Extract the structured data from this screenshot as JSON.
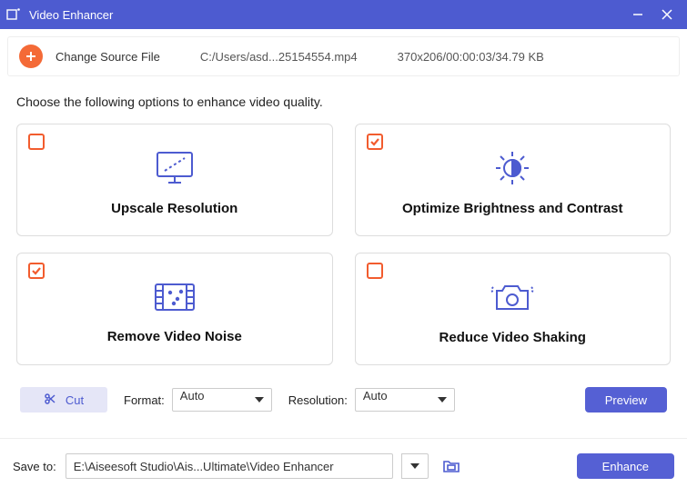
{
  "window": {
    "title": "Video Enhancer"
  },
  "source": {
    "change_label": "Change Source File",
    "path": "C:/Users/asd...25154554.mp4",
    "meta": "370x206/00:00:03/34.79 KB"
  },
  "instruction": "Choose the following options to enhance video quality.",
  "options": {
    "upscale": {
      "label": "Upscale Resolution",
      "checked": false
    },
    "optimize": {
      "label": "Optimize Brightness and Contrast",
      "checked": true
    },
    "denoise": {
      "label": "Remove Video Noise",
      "checked": true
    },
    "deshake": {
      "label": "Reduce Video Shaking",
      "checked": false
    }
  },
  "controls": {
    "cut_label": "Cut",
    "format_label": "Format:",
    "format_value": "Auto",
    "resolution_label": "Resolution:",
    "resolution_value": "Auto",
    "preview_label": "Preview"
  },
  "footer": {
    "save_to_label": "Save to:",
    "save_path": "E:\\Aiseesoft Studio\\Ais...Ultimate\\Video Enhancer",
    "enhance_label": "Enhance"
  }
}
